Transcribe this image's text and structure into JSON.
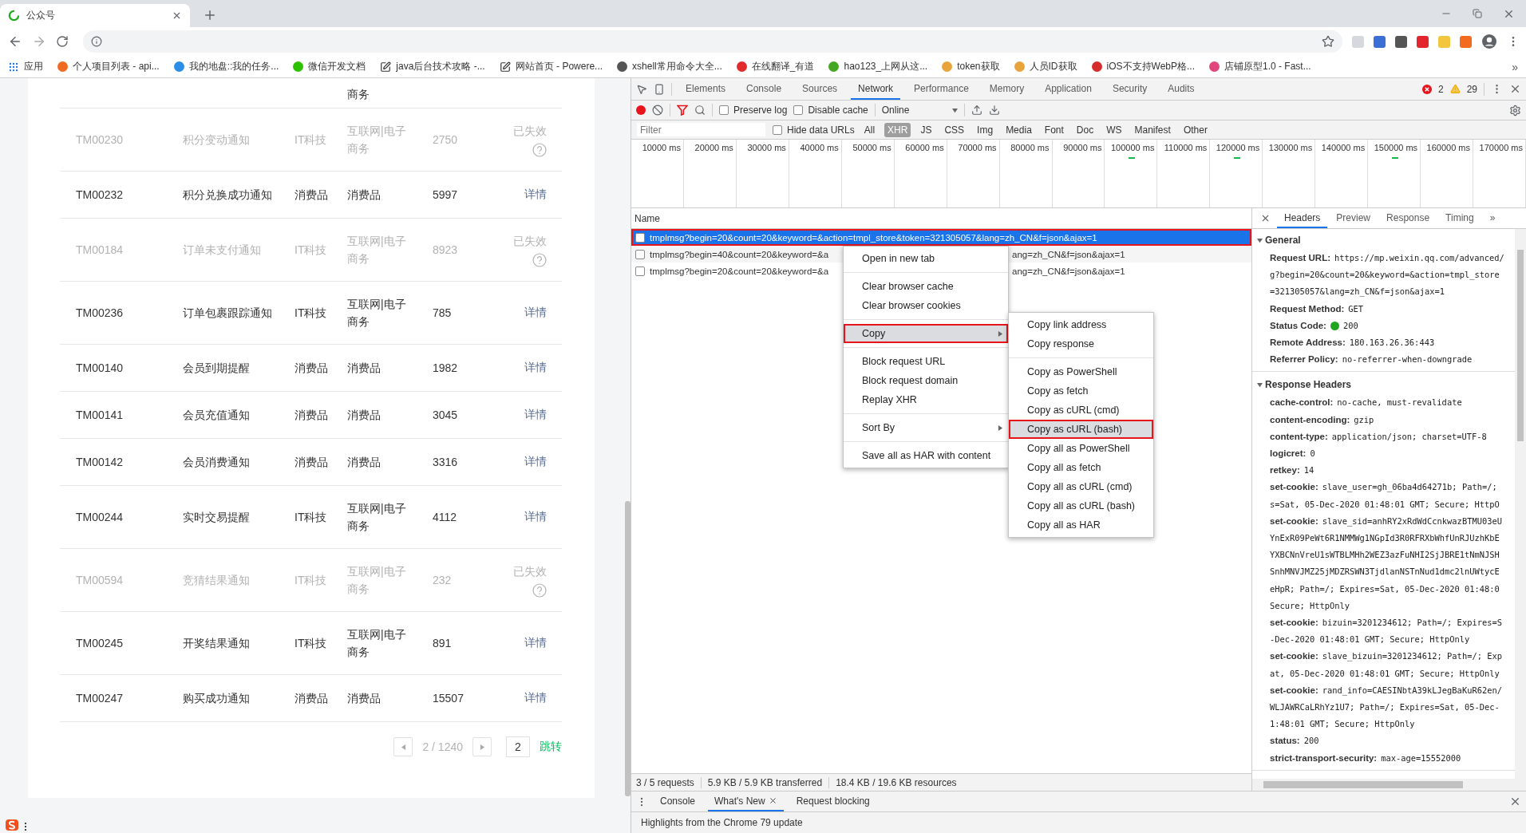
{
  "browser": {
    "tab": {
      "title": "公众号"
    },
    "bookmarks": [
      {
        "kind": "apps",
        "label": "应用"
      },
      {
        "kind": "favicon",
        "label": "个人项目列表 - api...",
        "color": "#f06a21"
      },
      {
        "kind": "favicon",
        "label": "我的地盘::我的任务...",
        "color": "#2a8ee6"
      },
      {
        "kind": "favicon",
        "label": "微信开发文档",
        "color": "#2dc100"
      },
      {
        "kind": "edit",
        "label": "java后台技术攻略 -..."
      },
      {
        "kind": "edit",
        "label": "网站首页 - Powere..."
      },
      {
        "kind": "favicon",
        "label": "xshell常用命令大全...",
        "color": "#555555"
      },
      {
        "kind": "favicon",
        "label": "在线翻译_有道",
        "color": "#e12b2b"
      },
      {
        "kind": "favicon",
        "label": "hao123_上网从这...",
        "color": "#44a724"
      },
      {
        "kind": "favicon",
        "label": "token获取",
        "color": "#e8a33a"
      },
      {
        "kind": "favicon",
        "label": "人员ID获取",
        "color": "#e8a33a"
      },
      {
        "kind": "favicon",
        "label": "iOS不支持WebP格...",
        "color": "#d62b2b"
      },
      {
        "kind": "favicon",
        "label": "店铺原型1.0 - Fast...",
        "color": "#e0457b"
      }
    ],
    "bookmarks_more": "»"
  },
  "table": {
    "top_fragment": "商务",
    "rows": [
      {
        "id": "TM00230",
        "name": "积分变动通知",
        "industry": "IT科技",
        "sub_industry": "互联网|电子商务",
        "count": "2750",
        "expired": true,
        "action": "已失效"
      },
      {
        "id": "TM00232",
        "name": "积分兑换成功通知",
        "industry": "消费品",
        "sub_industry": "消费品",
        "count": "5997",
        "expired": false,
        "action": "详情"
      },
      {
        "id": "TM00184",
        "name": "订单未支付通知",
        "industry": "IT科技",
        "sub_industry": "互联网|电子商务",
        "count": "8923",
        "expired": true,
        "action": "已失效"
      },
      {
        "id": "TM00236",
        "name": "订单包裹跟踪通知",
        "industry": "IT科技",
        "sub_industry": "互联网|电子商务",
        "count": "785",
        "expired": false,
        "action": "详情"
      },
      {
        "id": "TM00140",
        "name": "会员到期提醒",
        "industry": "消费品",
        "sub_industry": "消费品",
        "count": "1982",
        "expired": false,
        "action": "详情"
      },
      {
        "id": "TM00141",
        "name": "会员充值通知",
        "industry": "消费品",
        "sub_industry": "消费品",
        "count": "3045",
        "expired": false,
        "action": "详情"
      },
      {
        "id": "TM00142",
        "name": "会员消费通知",
        "industry": "消费品",
        "sub_industry": "消费品",
        "count": "3316",
        "expired": false,
        "action": "详情"
      },
      {
        "id": "TM00244",
        "name": "实时交易提醒",
        "industry": "IT科技",
        "sub_industry": "互联网|电子商务",
        "count": "4112",
        "expired": false,
        "action": "详情"
      },
      {
        "id": "TM00594",
        "name": "竞猜结果通知",
        "industry": "IT科技",
        "sub_industry": "互联网|电子商务",
        "count": "232",
        "expired": true,
        "action": "已失效"
      },
      {
        "id": "TM00245",
        "name": "开奖结果通知",
        "industry": "IT科技",
        "sub_industry": "互联网|电子商务",
        "count": "891",
        "expired": false,
        "action": "详情"
      },
      {
        "id": "TM00247",
        "name": "购买成功通知",
        "industry": "消费品",
        "sub_industry": "消费品",
        "count": "15507",
        "expired": false,
        "action": "详情"
      }
    ],
    "pagination": {
      "page_info": "2 / 1240",
      "page_input": "2",
      "jump": "跳转"
    }
  },
  "devtools": {
    "tabs": [
      {
        "label": "Elements",
        "selected": false
      },
      {
        "label": "Console",
        "selected": false
      },
      {
        "label": "Sources",
        "selected": false
      },
      {
        "label": "Network",
        "selected": true
      },
      {
        "label": "Performance",
        "selected": false
      },
      {
        "label": "Memory",
        "selected": false
      },
      {
        "label": "Application",
        "selected": false
      },
      {
        "label": "Security",
        "selected": false
      },
      {
        "label": "Audits",
        "selected": false
      }
    ],
    "errors": "2",
    "warnings": "29",
    "toolbar": {
      "recording": true,
      "filter_active": true,
      "preserve_log": false,
      "preserve_log_label": "Preserve log",
      "disable_cache": false,
      "disable_cache_label": "Disable cache",
      "throttle": "Online"
    },
    "filter": {
      "placeholder": "Filter",
      "hide_data_urls": false,
      "hide_data_urls_label": "Hide data URLs",
      "types": [
        {
          "label": "All",
          "selected": false
        },
        {
          "label": "XHR",
          "selected": true
        },
        {
          "label": "JS",
          "selected": false
        },
        {
          "label": "CSS",
          "selected": false
        },
        {
          "label": "Img",
          "selected": false
        },
        {
          "label": "Media",
          "selected": false
        },
        {
          "label": "Font",
          "selected": false
        },
        {
          "label": "Doc",
          "selected": false
        },
        {
          "label": "WS",
          "selected": false
        },
        {
          "label": "Manifest",
          "selected": false
        },
        {
          "label": "Other",
          "selected": false
        }
      ]
    },
    "timeline": [
      {
        "label": "10000 ms",
        "has_request": false
      },
      {
        "label": "20000 ms",
        "has_request": false
      },
      {
        "label": "30000 ms",
        "has_request": false
      },
      {
        "label": "40000 ms",
        "has_request": false
      },
      {
        "label": "50000 ms",
        "has_request": false
      },
      {
        "label": "60000 ms",
        "has_request": false
      },
      {
        "label": "70000 ms",
        "has_request": false
      },
      {
        "label": "80000 ms",
        "has_request": false
      },
      {
        "label": "90000 ms",
        "has_request": false
      },
      {
        "label": "100000 ms",
        "has_request": true
      },
      {
        "label": "110000 ms",
        "has_request": false
      },
      {
        "label": "120000 ms",
        "has_request": true
      },
      {
        "label": "130000 ms",
        "has_request": false
      },
      {
        "label": "140000 ms",
        "has_request": false
      },
      {
        "label": "150000 ms",
        "has_request": true
      },
      {
        "label": "160000 ms",
        "has_request": false
      },
      {
        "label": "170000 ms",
        "has_request": false
      }
    ],
    "requests": {
      "header": "Name",
      "rows": [
        {
          "parts": [
            "tmplmsg?begin=20&count=20&keyword=&action=tmpl_store&token=321305057&lang=zh_CN&f=json&ajax=1"
          ],
          "selected": true,
          "outlined": true
        },
        {
          "parts": [
            "tmplmsg?begin=40&count=20&keyword=&a",
            "ang=zh_CN&f=json&ajax=1"
          ],
          "selected": false,
          "outlined": false
        },
        {
          "parts": [
            "tmplmsg?begin=20&count=20&keyword=&a",
            "ang=zh_CN&f=json&ajax=1"
          ],
          "selected": false,
          "outlined": false
        }
      ]
    },
    "menu": [
      [
        {
          "label": "Open in new tab",
          "submenu": false,
          "highlighted": false,
          "outlined": false
        }
      ],
      [
        {
          "label": "Clear browser cache",
          "submenu": false,
          "highlighted": false,
          "outlined": false
        },
        {
          "label": "Clear browser cookies",
          "submenu": false,
          "highlighted": false,
          "outlined": false
        }
      ],
      [
        {
          "label": "Copy",
          "submenu": true,
          "highlighted": true,
          "outlined": true
        }
      ],
      [
        {
          "label": "Block request URL",
          "submenu": false,
          "highlighted": false,
          "outlined": false
        },
        {
          "label": "Block request domain",
          "submenu": false,
          "highlighted": false,
          "outlined": false
        },
        {
          "label": "Replay XHR",
          "submenu": false,
          "highlighted": false,
          "outlined": false
        }
      ],
      [
        {
          "label": "Sort By",
          "submenu": true,
          "highlighted": false,
          "outlined": false
        }
      ],
      [
        {
          "label": "Save all as HAR with content",
          "submenu": false,
          "highlighted": false,
          "outlined": false
        }
      ]
    ],
    "submenu": [
      [
        {
          "label": "Copy link address",
          "highlighted": false,
          "outlined": false
        },
        {
          "label": "Copy response",
          "highlighted": false,
          "outlined": false
        }
      ],
      [
        {
          "label": "Copy as PowerShell",
          "highlighted": false,
          "outlined": false
        },
        {
          "label": "Copy as fetch",
          "highlighted": false,
          "outlined": false
        },
        {
          "label": "Copy as cURL (cmd)",
          "highlighted": false,
          "outlined": false
        },
        {
          "label": "Copy as cURL (bash)",
          "highlighted": true,
          "outlined": true
        },
        {
          "label": "Copy all as PowerShell",
          "highlighted": false,
          "outlined": false
        },
        {
          "label": "Copy all as fetch",
          "highlighted": false,
          "outlined": false
        },
        {
          "label": "Copy all as cURL (cmd)",
          "highlighted": false,
          "outlined": false
        },
        {
          "label": "Copy all as cURL (bash)",
          "highlighted": false,
          "outlined": false
        },
        {
          "label": "Copy all as HAR",
          "highlighted": false,
          "outlined": false
        }
      ]
    ],
    "detail": {
      "tabs": [
        {
          "label": "Headers",
          "selected": true
        },
        {
          "label": "Preview",
          "selected": false
        },
        {
          "label": "Response",
          "selected": false
        },
        {
          "label": "Timing",
          "selected": false
        }
      ],
      "more": "»",
      "sections": [
        {
          "title": "General",
          "expanded": true,
          "items": [
            {
              "name": "Request URL:",
              "lines": [
                "https://mp.weixin.qq.com/advanced/",
                "g?begin=20&count=20&keyword=&action=tmpl_store",
                "=321305057&lang=zh_CN&f=json&ajax=1"
              ]
            },
            {
              "name": "Request Method:",
              "lines": [
                "GET"
              ]
            },
            {
              "name": "Status Code:",
              "lines": [
                "200"
              ],
              "color": "#1fa51f"
            },
            {
              "name": "Remote Address:",
              "lines": [
                "180.163.26.36:443"
              ]
            },
            {
              "name": "Referrer Policy:",
              "lines": [
                "no-referrer-when-downgrade"
              ]
            }
          ]
        },
        {
          "title": "Response Headers",
          "expanded": true,
          "items": [
            {
              "name": "cache-control:",
              "lines": [
                "no-cache, must-revalidate"
              ]
            },
            {
              "name": "content-encoding:",
              "lines": [
                "gzip"
              ]
            },
            {
              "name": "content-type:",
              "lines": [
                "application/json; charset=UTF-8"
              ]
            },
            {
              "name": "logicret:",
              "lines": [
                "0"
              ]
            },
            {
              "name": "retkey:",
              "lines": [
                "14"
              ]
            },
            {
              "name": "set-cookie:",
              "lines": [
                "slave_user=gh_06ba4d64271b; Path=/;",
                "s=Sat, 05-Dec-2020 01:48:01 GMT; Secure; HttpO"
              ]
            },
            {
              "name": "set-cookie:",
              "lines": [
                "slave_sid=anhRY2xRdWdCcnkwazBTMU03eU",
                "YnExR09PeWt6R1NMMWg1NGpId3R0RFRXbWhfUnRJUzhKbE",
                "YXBCNnVreU1sWTBLMHh2WEZ3azFuNHI2SjJBRE1tNmNJSH",
                "SnhMNVJMZ25jMDZRSWN3TjdlanNSTnNud1dmc2lnUWtycE",
                "eHpR; Path=/; Expires=Sat, 05-Dec-2020 01:48:0",
                "Secure; HttpOnly"
              ]
            },
            {
              "name": "set-cookie:",
              "lines": [
                "bizuin=3201234612; Path=/; Expires=S",
                "-Dec-2020 01:48:01 GMT; Secure; HttpOnly"
              ]
            },
            {
              "name": "set-cookie:",
              "lines": [
                "slave_bizuin=3201234612; Path=/; Exp",
                "at, 05-Dec-2020 01:48:01 GMT; Secure; HttpOnly"
              ]
            },
            {
              "name": "set-cookie:",
              "lines": [
                "rand_info=CAESINbtA39kLJegBaKuR62en/",
                "WLJAWRCaLRhYz1U7; Path=/; Expires=Sat, 05-Dec-",
                "1:48:01 GMT; Secure; HttpOnly"
              ]
            },
            {
              "name": "status:",
              "lines": [
                "200"
              ]
            },
            {
              "name": "strict-transport-security:",
              "lines": [
                "max-age=15552000"
              ]
            }
          ]
        }
      ]
    },
    "status_bar": [
      "3 / 5 requests",
      "5.9 KB / 5.9 KB transferred",
      "18.4 KB / 19.6 KB resources"
    ],
    "drawer": {
      "tabs": [
        {
          "label": "Console",
          "selected": false,
          "closable": false
        },
        {
          "label": "What's New",
          "selected": true,
          "closable": true
        },
        {
          "label": "Request blocking",
          "selected": false,
          "closable": false
        }
      ],
      "content": "Highlights from the Chrome 79 update"
    }
  }
}
